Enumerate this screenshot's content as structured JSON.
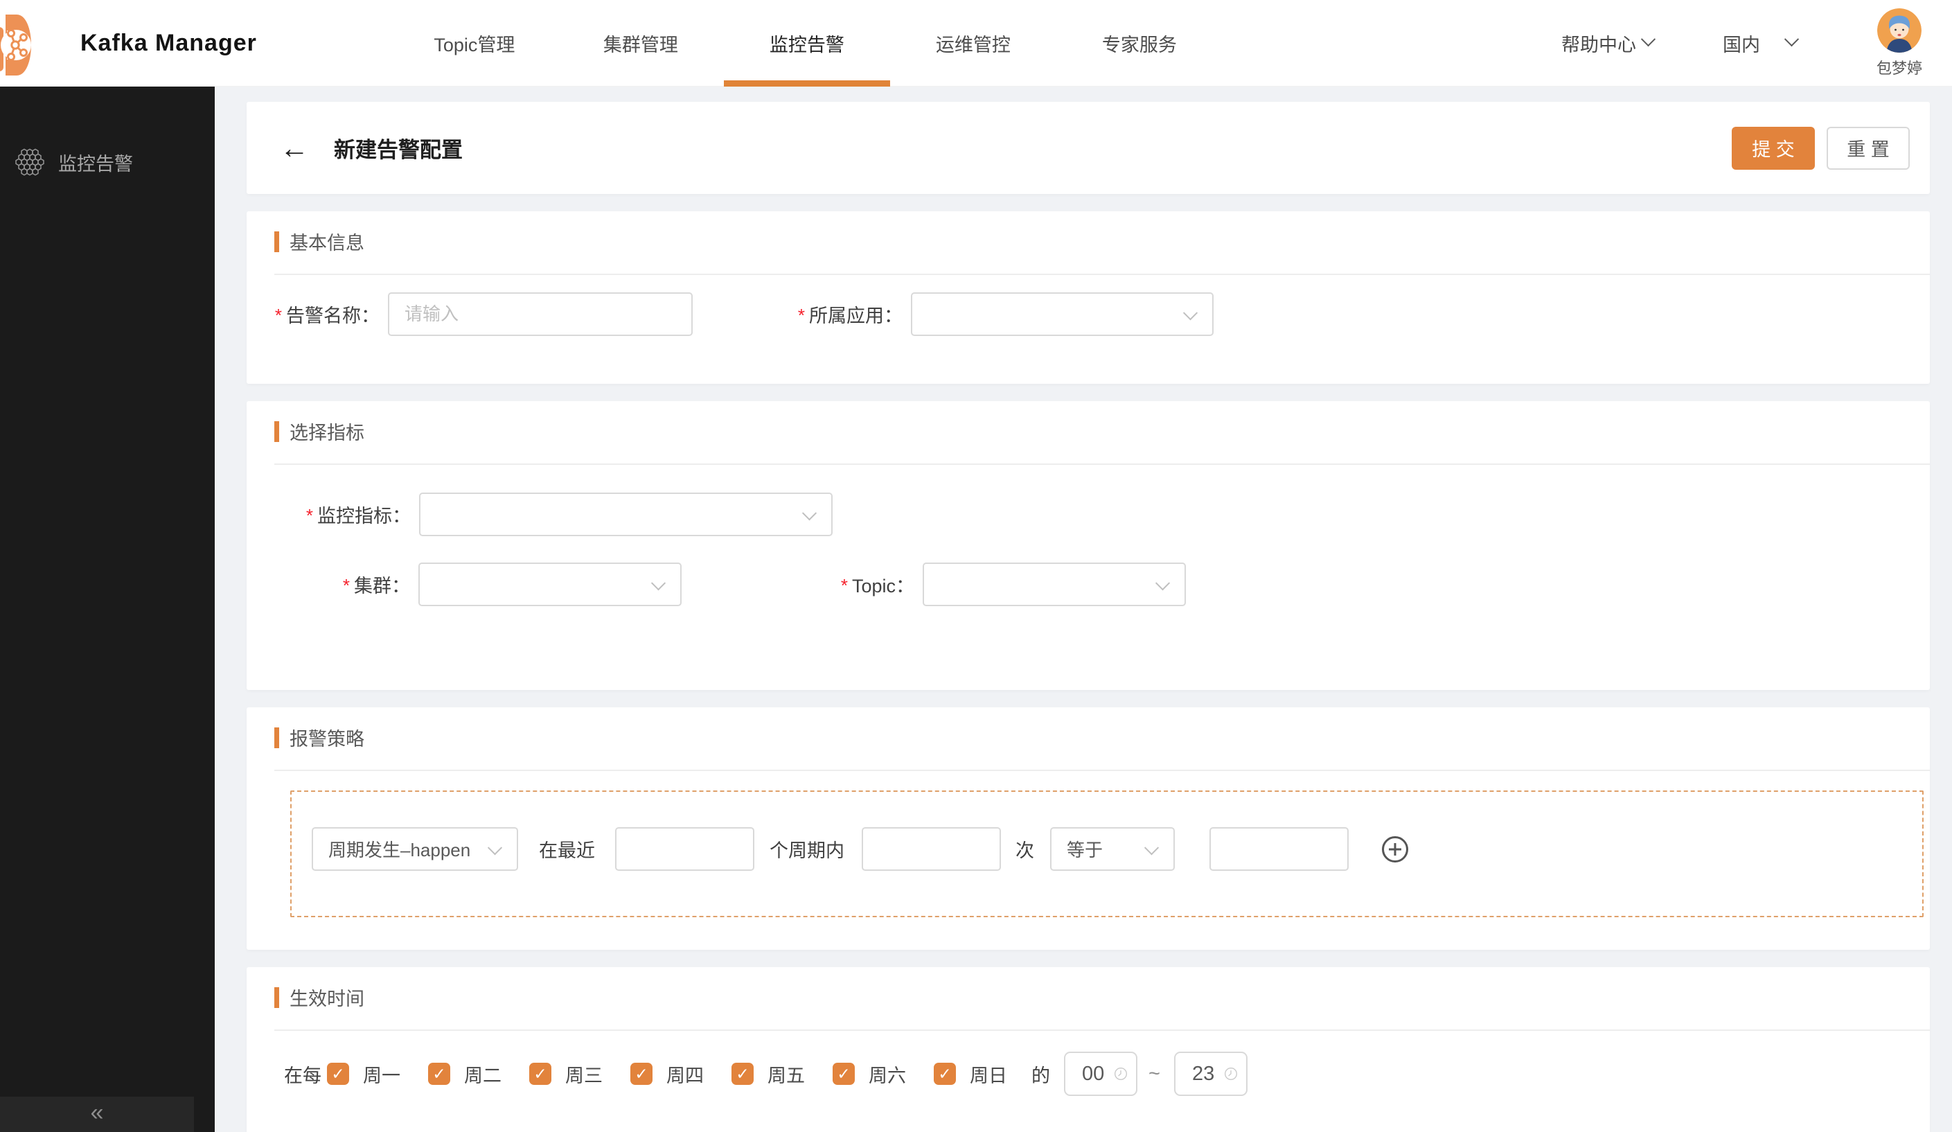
{
  "navbar": {
    "brand": "Kafka Manager",
    "items": [
      {
        "label": "Topic管理"
      },
      {
        "label": "集群管理"
      },
      {
        "label": "监控告警"
      },
      {
        "label": "运维管控"
      },
      {
        "label": "专家服务"
      }
    ],
    "help_label": "帮助中心",
    "region_label": "国内",
    "username": "包梦婷"
  },
  "sidebar": {
    "item_label": "监控告警",
    "collapse_glyph": "«"
  },
  "header": {
    "back_glyph": "←",
    "title": "新建告警配置",
    "submit_label": "提 交",
    "reset_label": "重 置"
  },
  "required_mark": "*",
  "basic_info": {
    "title": "基本信息",
    "alarm_name": {
      "label": "告警名称：",
      "placeholder": "请输入",
      "value": ""
    },
    "app": {
      "label": "所属应用：",
      "value": ""
    }
  },
  "metrics": {
    "title": "选择指标",
    "monitor_metric": {
      "label": "监控指标：",
      "value": ""
    },
    "cluster": {
      "label": "集群：",
      "value": ""
    },
    "topic": {
      "label": "Topic：",
      "value": ""
    }
  },
  "strategy": {
    "title": "报警策略",
    "period_select": "周期发生–happen",
    "text_recent": "在最近",
    "recent_value": "",
    "text_periods": "个周期内",
    "periods_value": "",
    "text_times": "次",
    "compare_select": "等于",
    "threshold_value": ""
  },
  "schedule": {
    "title": "生效时间",
    "prefix": "在每",
    "days": [
      "周一",
      "周二",
      "周三",
      "周四",
      "周五",
      "周六",
      "周日"
    ],
    "check_glyph": "✓",
    "suffix": "的",
    "start_time": "00",
    "tilde": "~",
    "end_time": "23"
  },
  "colors": {
    "accent": "#e2833c",
    "logo_orange": "#ed9155",
    "avatar_bg": "#f0a14e",
    "sidebar_bg": "#1b1b1b"
  }
}
